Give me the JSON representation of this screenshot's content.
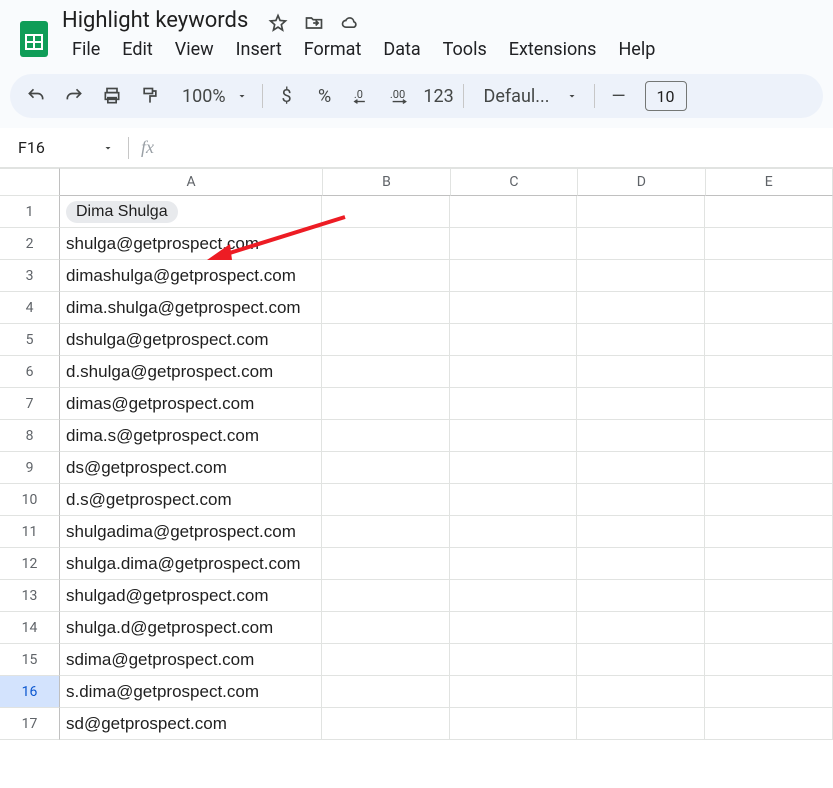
{
  "doc_title": "Highlight keywords",
  "menus": [
    "File",
    "Edit",
    "View",
    "Insert",
    "Format",
    "Data",
    "Tools",
    "Extensions",
    "Help"
  ],
  "toolbar": {
    "zoom": "100%",
    "currency": "$",
    "percent": "%",
    "num_123": "123",
    "font": "Defaul...",
    "font_size": "10",
    "minus": "—"
  },
  "name_box": "F16",
  "fx": "fx",
  "columns": [
    "A",
    "B",
    "C",
    "D",
    "E"
  ],
  "selected_row": 16,
  "rows": [
    {
      "n": 1,
      "a_chip": "Dima Shulga"
    },
    {
      "n": 2,
      "a": "shulga@getprospect.com"
    },
    {
      "n": 3,
      "a": "dimashulga@getprospect.com"
    },
    {
      "n": 4,
      "a": "dima.shulga@getprospect.com"
    },
    {
      "n": 5,
      "a": "dshulga@getprospect.com"
    },
    {
      "n": 6,
      "a": "d.shulga@getprospect.com"
    },
    {
      "n": 7,
      "a": "dimas@getprospect.com"
    },
    {
      "n": 8,
      "a": "dima.s@getprospect.com"
    },
    {
      "n": 9,
      "a": "ds@getprospect.com"
    },
    {
      "n": 10,
      "a": "d.s@getprospect.com"
    },
    {
      "n": 11,
      "a": "shulgadima@getprospect.com"
    },
    {
      "n": 12,
      "a": "shulga.dima@getprospect.com"
    },
    {
      "n": 13,
      "a": "shulgad@getprospect.com"
    },
    {
      "n": 14,
      "a": "shulga.d@getprospect.com"
    },
    {
      "n": 15,
      "a": "sdima@getprospect.com"
    },
    {
      "n": 16,
      "a": "s.dima@getprospect.com"
    },
    {
      "n": 17,
      "a": "sd@getprospect.com"
    }
  ]
}
